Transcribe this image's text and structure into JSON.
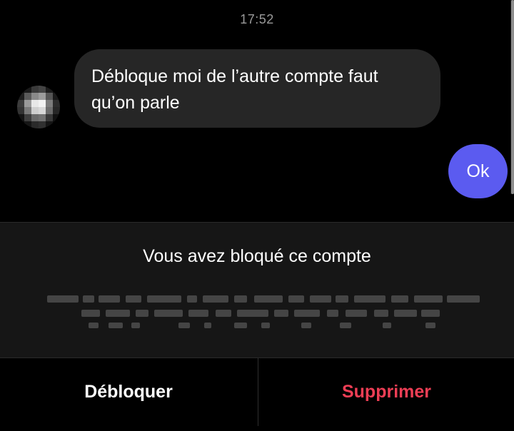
{
  "chat": {
    "timestamp": "17:52",
    "incoming_message": "Débloque moi de l’autre compte faut qu’on parle",
    "outgoing_message": "Ok"
  },
  "avatar": {
    "icon": "pixelated-avatar-icon",
    "pixels": [
      "#101010",
      "#1a1a1a",
      "#3a3a3a",
      "#444444",
      "#1c1c1c",
      "#0d0d0d",
      "#1e1e1e",
      "#5a5a5a",
      "#8a8a8a",
      "#9c9c9c",
      "#555555",
      "#1a1a1a",
      "#3c3c3c",
      "#9a9a9a",
      "#e8e8e8",
      "#f2f2f2",
      "#7c7c7c",
      "#2c2c2c",
      "#333333",
      "#7a7a7a",
      "#cfcfcf",
      "#d8d8d8",
      "#6c6c6c",
      "#262626",
      "#141414",
      "#3e3e3e",
      "#6a6a6a",
      "#727272",
      "#383838",
      "#111111",
      "#0a0a0a",
      "#161616",
      "#2a2a2a",
      "#303030",
      "#151515",
      "#080808"
    ]
  },
  "blocked_panel": {
    "title": "Vous avez bloqué ce compte"
  },
  "actions": {
    "unblock_label": "Débloquer",
    "delete_label": "Supprimer"
  },
  "colors": {
    "background": "#000000",
    "incoming_bubble": "#262626",
    "outgoing_bubble": "#5b5bf0",
    "delete_text": "#ee3e55",
    "timestamp_text": "#9a9a9a"
  }
}
